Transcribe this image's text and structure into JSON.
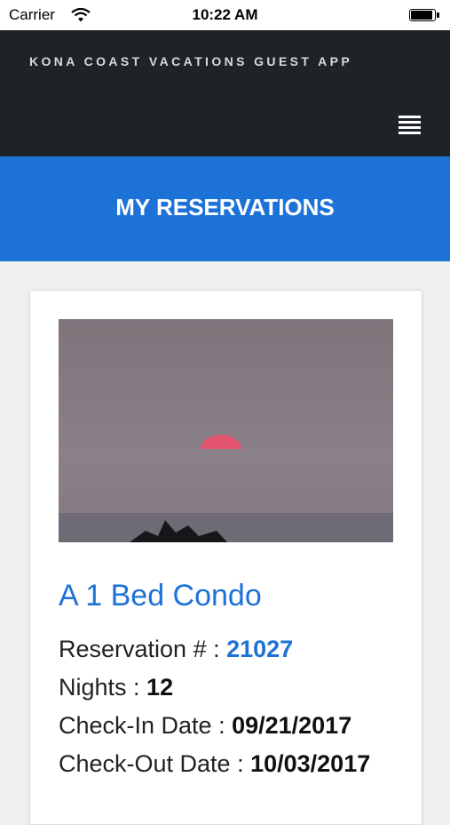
{
  "status_bar": {
    "carrier": "Carrier",
    "time": "10:22 AM"
  },
  "header": {
    "app_title": "KONA COAST VACATIONS GUEST APP",
    "menu_icon": "hamburger-menu-icon"
  },
  "page": {
    "title": "MY RESERVATIONS"
  },
  "reservation": {
    "unit_name": "A 1 Bed Condo",
    "photo": "sunset-over-ocean",
    "reservation_label": "Reservation # : ",
    "reservation_number": "21027",
    "nights_label": "Nights : ",
    "nights": "12",
    "checkin_label": "Check-In Date : ",
    "checkin_date": "09/21/2017",
    "checkout_label": "Check-Out Date : ",
    "checkout_date": "10/03/2017"
  },
  "colors": {
    "accent": "#1d72d8",
    "header_bg": "#1f2327",
    "page_bg": "#efefef"
  }
}
